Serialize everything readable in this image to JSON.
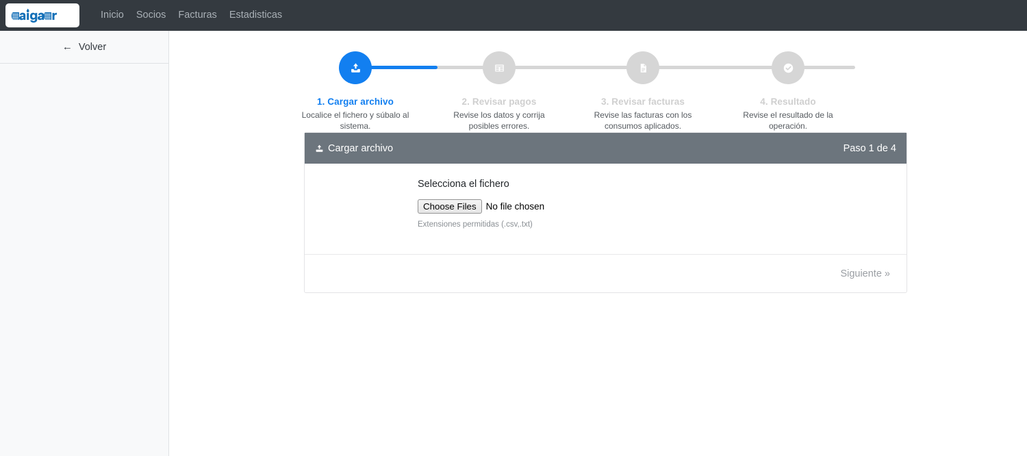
{
  "navbar": {
    "brand": {
      "text": "aigar",
      "color": "#1570b8",
      "icon": "aigar-logo"
    },
    "background": "#343a40",
    "links": [
      {
        "label": "Inicio",
        "name": "nav-link-inicio"
      },
      {
        "label": "Socios",
        "name": "nav-link-socios"
      },
      {
        "label": "Facturas",
        "name": "nav-link-facturas"
      },
      {
        "label": "Estadisticas",
        "name": "nav-link-estadisticas"
      }
    ]
  },
  "sidebar": {
    "back": {
      "label": "Volver",
      "icon": "arrow-left-icon",
      "arrow": "←"
    },
    "background": "#f8f9fa"
  },
  "stepper": {
    "progress_percent": 16.5,
    "active_color": "#127ff0",
    "inactive_color": "#d6d6d6",
    "steps": [
      {
        "title": "1. Cargar archivo",
        "desc": "Localice el fichero y súbalo al sistema.",
        "icon": "upload-icon",
        "active": true
      },
      {
        "title": "2. Revisar pagos",
        "desc": "Revise los datos y corrija posibles errores.",
        "icon": "table-grid-icon",
        "active": false
      },
      {
        "title": "3. Revisar facturas",
        "desc": "Revise las facturas con los consumos aplicados.",
        "icon": "document-icon",
        "active": false
      },
      {
        "title": "4. Resultado",
        "desc": "Revise el resultado de la operación.",
        "icon": "check-circle-icon",
        "active": false
      }
    ]
  },
  "card": {
    "header": {
      "title": "Cargar archivo",
      "icon": "upload-icon",
      "step_counter": "Paso 1 de 4",
      "background": "#6c757d"
    },
    "body": {
      "file_label": "Selecciona el fichero",
      "choose_files_button": "Choose Files",
      "no_file_text": "No file chosen",
      "hint": "Extensiones permitidas (.csv,.txt)"
    },
    "footer": {
      "next_label": "Siguiente »"
    }
  }
}
